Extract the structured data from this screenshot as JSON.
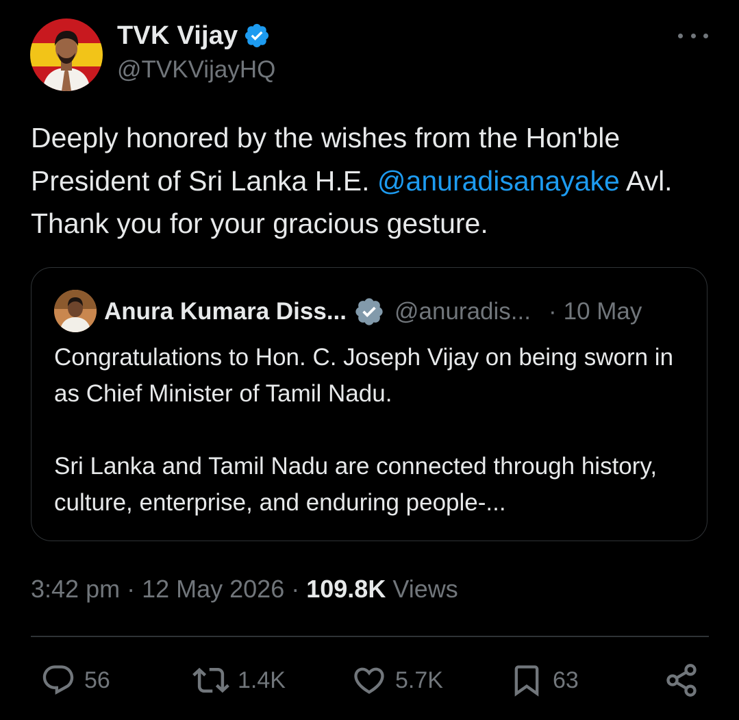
{
  "tweet": {
    "display_name": "TVK Vijay",
    "handle": "@TVKVijayHQ",
    "text_part1": "Deeply honored by the wishes from the Hon'ble President of Sri Lanka H.E. ",
    "mention": "@anuradisanayake",
    "text_part2": " Avl. Thank you for your gracious gesture.",
    "time": "3:42 pm",
    "date": "12 May 2026",
    "views_count": "109.8K",
    "views_label": "Views",
    "separator": "·"
  },
  "quote": {
    "display_name": "Anura Kumara Diss...",
    "handle": "@anuradis...",
    "separator": "·",
    "date": "10 May",
    "text": "Congratulations to Hon. C. Joseph Vijay on being sworn in as Chief Minister of Tamil Nadu.\n\nSri Lanka and Tamil Nadu are connected through history, culture, enterprise, and enduring people-..."
  },
  "actions": {
    "replies": "56",
    "reposts": "1.4K",
    "likes": "5.7K",
    "bookmarks": "63"
  },
  "colors": {
    "background": "#000000",
    "text": "#e7e9ea",
    "muted": "#71767b",
    "accent": "#1d9bf0",
    "border": "#2f3336",
    "quote_verified": "#829aab"
  },
  "icons": {
    "verified": "verified-badge-icon",
    "more": "more-horizontal-icon",
    "reply": "reply-icon",
    "repost": "repost-icon",
    "like": "heart-icon",
    "bookmark": "bookmark-icon",
    "share": "share-icon"
  }
}
